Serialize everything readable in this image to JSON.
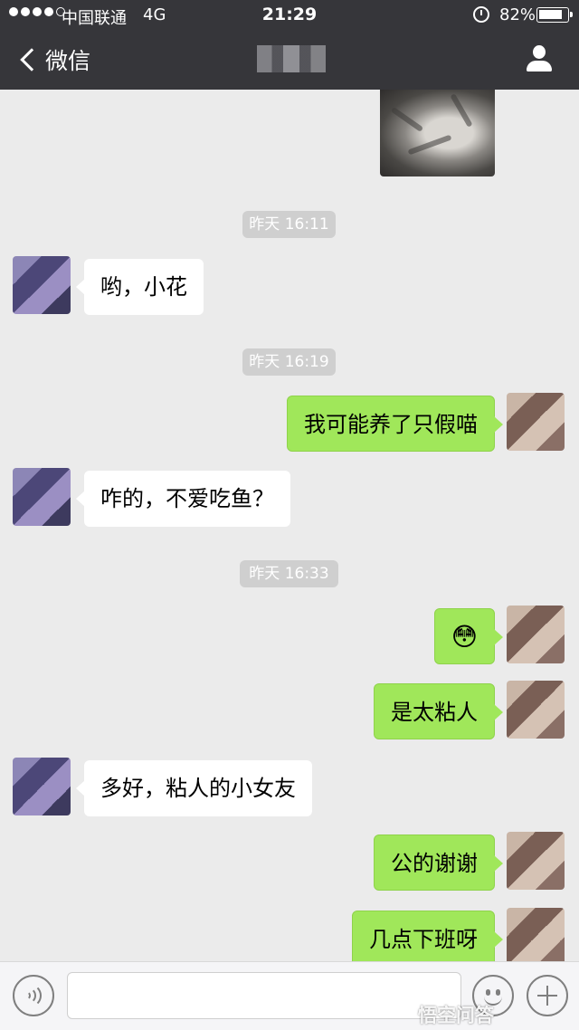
{
  "status_bar": {
    "carrier": "中国联通",
    "network": "4G",
    "time": "21:29",
    "battery_percent": "82%",
    "battery_level": 0.82,
    "signal_bars_filled": 4,
    "signal_bars_total": 5
  },
  "nav": {
    "back_label": "微信",
    "back_icon": "chevron-left-icon",
    "profile_icon": "person-icon"
  },
  "messages": {
    "ts1": "昨天 16:11",
    "m1": "哟，小花",
    "ts2": "昨天 16:19",
    "m2": "我可能养了只假喵",
    "m3": "咋的，不爱吃鱼？",
    "ts3": "昨天 16:33",
    "m4": "😳",
    "m5": "是太粘人",
    "m6": "多好，粘人的小女友",
    "m7": "公的谢谢",
    "m8": "几点下班呀"
  },
  "input_bar": {
    "voice_icon": "voice-icon",
    "emoji_icon": "smiley-icon",
    "plus_icon": "plus-icon"
  },
  "watermark": "悟空问答",
  "colors": {
    "nav_bg": "#36363a",
    "chat_bg": "#ebebeb",
    "sent_bubble": "#a0e75a",
    "received_bubble": "#ffffff"
  }
}
